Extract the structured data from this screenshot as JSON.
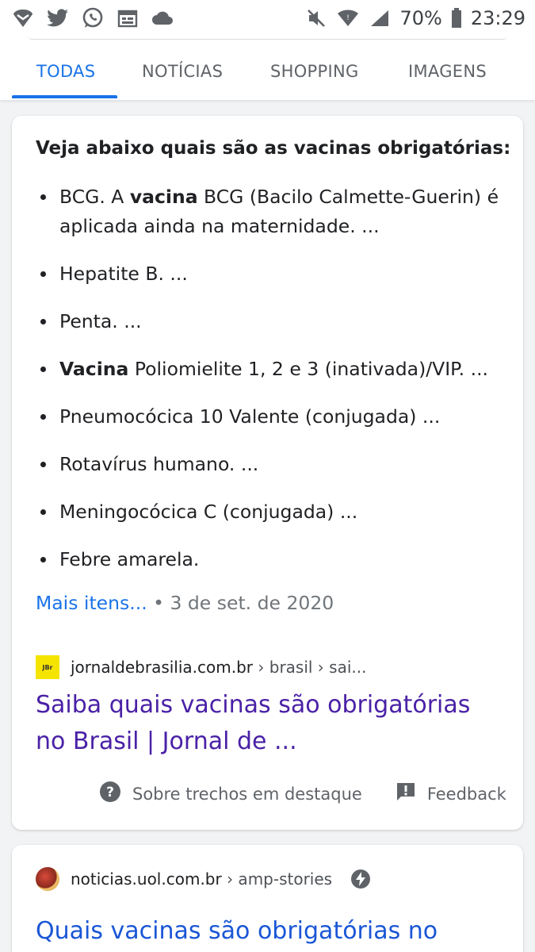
{
  "status_bar": {
    "battery": "70%",
    "time": "23:29"
  },
  "tabs": [
    {
      "label": "TODAS",
      "active": true
    },
    {
      "label": "NOTÍCIAS",
      "active": false
    },
    {
      "label": "SHOPPING",
      "active": false
    },
    {
      "label": "IMAGENS",
      "active": false
    }
  ],
  "featured_snippet": {
    "heading": "Veja abaixo quais são as vacinas obrigatórias:",
    "items": [
      {
        "bold_prefix": "",
        "pre": "BCG. A ",
        "bold": "vacina",
        "post": " BCG (Bacilo Calmette-Guerin) é aplicada ainda na maternidade. ..."
      },
      {
        "pre": "Hepatite B. ...",
        "bold": "",
        "post": ""
      },
      {
        "pre": "Penta. ...",
        "bold": "",
        "post": ""
      },
      {
        "pre": "",
        "bold": "Vacina",
        "post": " Poliomielite 1, 2 e 3 (inativada)/VIP. ..."
      },
      {
        "pre": "Pneumocócica 10 Valente (conjugada) ...",
        "bold": "",
        "post": ""
      },
      {
        "pre": "Rotavírus humano. ...",
        "bold": "",
        "post": ""
      },
      {
        "pre": "Meningocócica C (conjugada) ...",
        "bold": "",
        "post": ""
      },
      {
        "pre": "Febre amarela.",
        "bold": "",
        "post": ""
      }
    ],
    "more_link": "Mais itens...",
    "date": " • 3 de set. de 2020",
    "source_domain": "jornaldebrasilia.com.br",
    "source_path": " › brasil › sai...",
    "favicon_text": "JBr",
    "title": "Saiba quais vacinas são obrigatórias no Brasil | Jornal de ...",
    "about_label": "Sobre trechos em destaque",
    "feedback_label": "Feedback"
  },
  "result2": {
    "source_domain": "noticias.uol.com.br",
    "source_path": " › amp-stories",
    "title": "Quais vacinas são obrigatórias no"
  },
  "colors": {
    "accent": "#1a73e8",
    "visited_link": "#4a21a6",
    "text": "#202124",
    "muted": "#70757a"
  }
}
